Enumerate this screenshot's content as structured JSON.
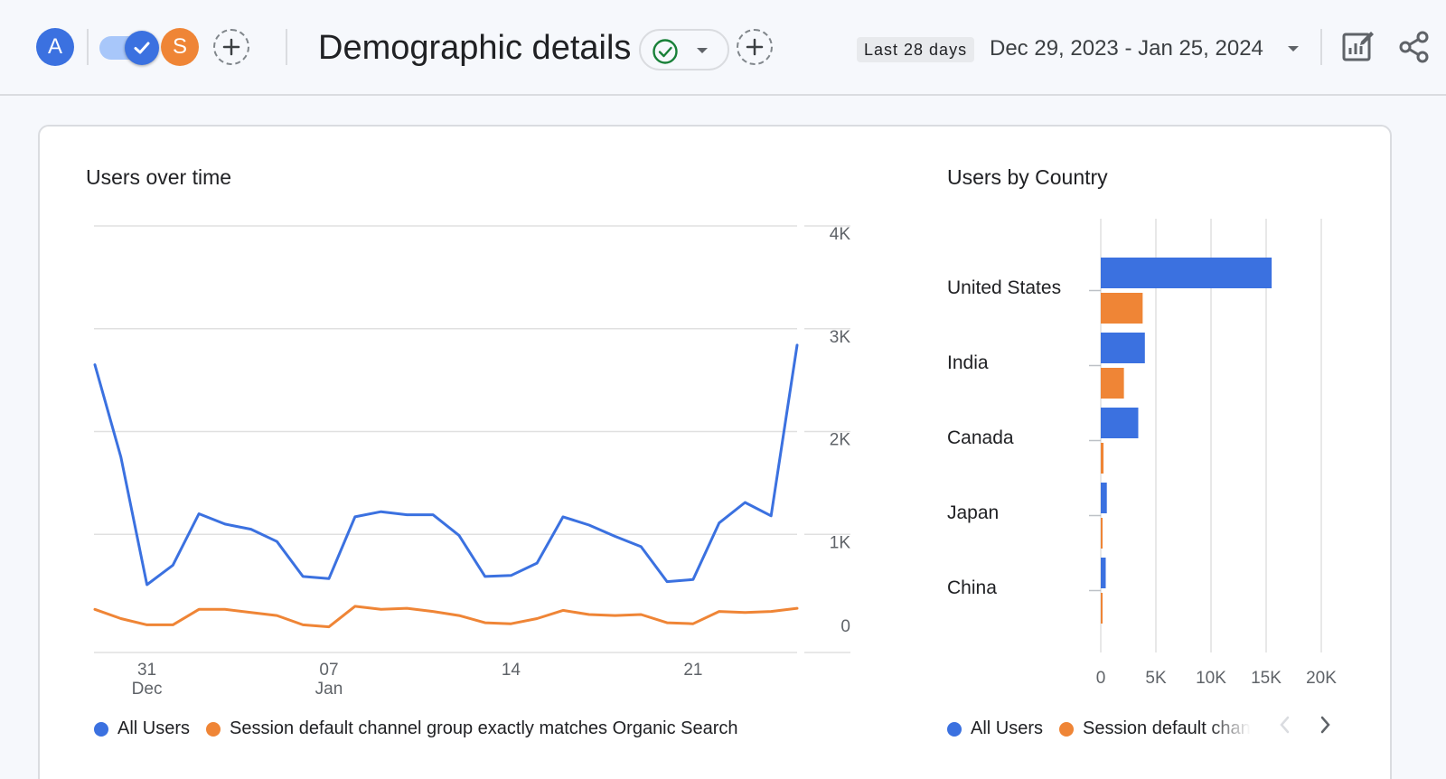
{
  "header": {
    "avatar_a": "A",
    "avatar_s": "S",
    "title": "Demographic details",
    "date_range_label": "Last 28 days",
    "date_range": "Dec 29, 2023 - Jan 25, 2024",
    "icons": [
      "add-comparison-icon",
      "check-circle-icon",
      "dropdown-icon",
      "edit-report-icon",
      "share-icon"
    ]
  },
  "colors": {
    "blue": "#3b71e0",
    "orange": "#ef8536",
    "avatar_a": "#3b71e0",
    "avatar_s": "#ef8536",
    "check_green": "#188038"
  },
  "line_chart": {
    "title": "Users over time",
    "legend": [
      "All Users",
      "Session default channel group exactly matches Organic Search"
    ]
  },
  "bar_chart": {
    "title": "Users by Country",
    "legend": [
      "All Users",
      "Session default chan"
    ]
  },
  "chart_data": [
    {
      "type": "line",
      "title": "Users over time",
      "x": [
        "Dec 29",
        "Dec 30",
        "Dec 31",
        "Jan 01",
        "Jan 02",
        "Jan 03",
        "Jan 04",
        "Jan 05",
        "Jan 06",
        "Jan 07",
        "Jan 08",
        "Jan 09",
        "Jan 10",
        "Jan 11",
        "Jan 12",
        "Jan 13",
        "Jan 14",
        "Jan 15",
        "Jan 16",
        "Jan 17",
        "Jan 18",
        "Jan 19",
        "Jan 20",
        "Jan 21",
        "Jan 22",
        "Jan 23",
        "Jan 24",
        "Jan 25"
      ],
      "x_ticks": [
        {
          "label": "31",
          "sub": "Dec",
          "at": "Dec 31"
        },
        {
          "label": "07",
          "sub": "Jan",
          "at": "Jan 07"
        },
        {
          "label": "14",
          "sub": "",
          "at": "Jan 14"
        },
        {
          "label": "21",
          "sub": "",
          "at": "Jan 21"
        }
      ],
      "y_ticks": [
        "0",
        "1K",
        "2K",
        "3K",
        "4K"
      ],
      "ylim": [
        0,
        4000
      ],
      "grid": true,
      "legend_position": "bottom",
      "series": [
        {
          "name": "All Users",
          "color": "#3b71e0",
          "values": [
            2650,
            1750,
            510,
            700,
            1200,
            1100,
            1050,
            930,
            590,
            570,
            1170,
            1220,
            1190,
            1190,
            990,
            590,
            600,
            720,
            1170,
            1090,
            980,
            880,
            540,
            560,
            1110,
            1310,
            1180,
            2840
          ]
        },
        {
          "name": "Session default channel group exactly matches Organic Search",
          "color": "#ef8536",
          "values": [
            270,
            180,
            120,
            120,
            270,
            270,
            240,
            210,
            120,
            100,
            300,
            270,
            280,
            250,
            210,
            140,
            130,
            180,
            260,
            220,
            210,
            220,
            140,
            130,
            250,
            240,
            250,
            280
          ]
        }
      ]
    },
    {
      "type": "bar",
      "orientation": "horizontal",
      "title": "Users by Country",
      "categories": [
        "United States",
        "India",
        "Canada",
        "Japan",
        "China"
      ],
      "x_ticks": [
        "0",
        "5K",
        "10K",
        "15K",
        "20K"
      ],
      "xlim": [
        0,
        20000
      ],
      "grid": true,
      "legend_position": "bottom",
      "series": [
        {
          "name": "All Users",
          "color": "#3b71e0",
          "values": [
            15500,
            4000,
            3400,
            550,
            450
          ]
        },
        {
          "name": "Session default chan",
          "color": "#ef8536",
          "values": [
            3800,
            2100,
            250,
            120,
            100
          ]
        }
      ]
    }
  ]
}
